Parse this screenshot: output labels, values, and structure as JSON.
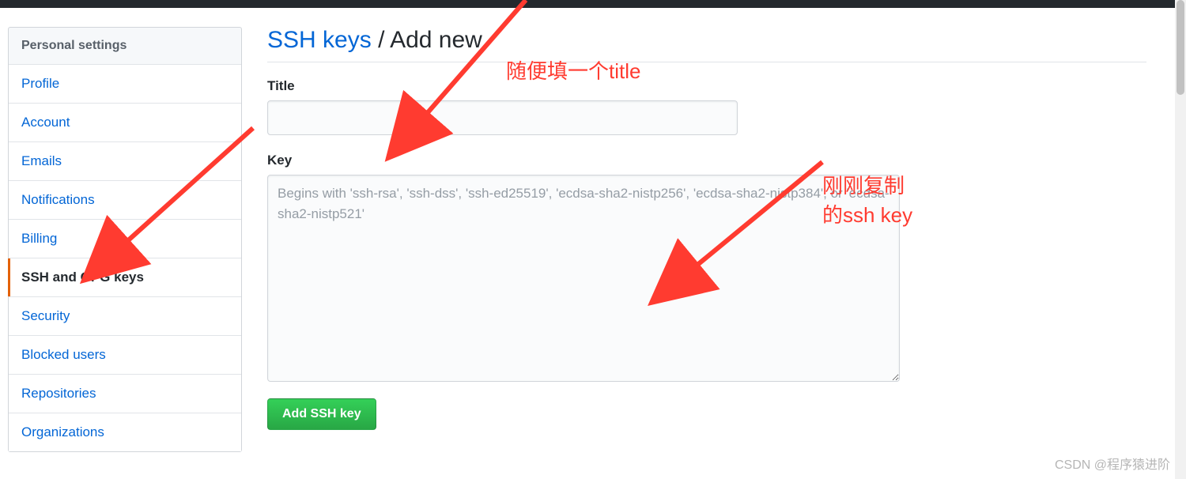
{
  "sidebar": {
    "header": "Personal settings",
    "items": [
      {
        "label": "Profile",
        "active": false
      },
      {
        "label": "Account",
        "active": false
      },
      {
        "label": "Emails",
        "active": false
      },
      {
        "label": "Notifications",
        "active": false
      },
      {
        "label": "Billing",
        "active": false
      },
      {
        "label": "SSH and GPG keys",
        "active": true
      },
      {
        "label": "Security",
        "active": false
      },
      {
        "label": "Blocked users",
        "active": false
      },
      {
        "label": "Repositories",
        "active": false
      },
      {
        "label": "Organizations",
        "active": false
      }
    ]
  },
  "page": {
    "breadcrumb_link": "SSH keys",
    "breadcrumb_sep": "/",
    "breadcrumb_current": "Add new"
  },
  "form": {
    "title_label": "Title",
    "title_value": "",
    "key_label": "Key",
    "key_value": "",
    "key_placeholder": "Begins with 'ssh-rsa', 'ssh-dss', 'ssh-ed25519', 'ecdsa-sha2-nistp256', 'ecdsa-sha2-nistp384', or 'ecdsa-sha2-nistp521'",
    "submit_label": "Add SSH key"
  },
  "annotations": {
    "title_hint": "随便填一个title",
    "key_hint_line1": "刚刚复制",
    "key_hint_line2": "的ssh key"
  },
  "watermark": "CSDN @程序猿进阶"
}
